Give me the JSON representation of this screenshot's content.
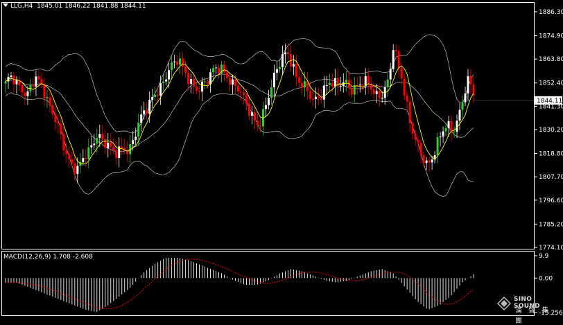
{
  "header": {
    "symbol": "LLG,H4",
    "ohlc": "1845.01 1846.22 1841.88 1844.11"
  },
  "price_axis": {
    "ticks": [
      "1886.30",
      "1874.90",
      "1863.80",
      "1852.40",
      "1841.30",
      "1830.20",
      "1818.80",
      "1807.70",
      "1796.60",
      "1785.20",
      "1774.10"
    ],
    "current_price": "1844.11"
  },
  "macd": {
    "label": "MACD(12,26,9) 1.708 -2.608",
    "ticks": [
      "9.9",
      "0.00",
      "-15.256"
    ]
  },
  "watermark": {
    "line1": "SINO SOUND",
    "line2": "漢 聲 集 團"
  },
  "colors": {
    "up": "#ffffff",
    "down": "#ff0000",
    "green_candle": "#32cd32",
    "ma": "#ffff00",
    "bands": "#c0c0c0",
    "signal": "#ff0000"
  },
  "chart_data": {
    "type": "candlestick",
    "title": "LLG,H4",
    "y_range": [
      1774.1,
      1886.3
    ],
    "close_path": [
      1852,
      1855,
      1853,
      1850,
      1849,
      1847,
      1852,
      1856,
      1853,
      1848,
      1842,
      1838,
      1835,
      1829,
      1822,
      1816,
      1812,
      1810,
      1814,
      1818,
      1821,
      1826,
      1829,
      1825,
      1823,
      1820,
      1818,
      1820,
      1822,
      1821,
      1824,
      1830,
      1835,
      1838,
      1841,
      1846,
      1849,
      1852,
      1856,
      1860,
      1861,
      1863,
      1859,
      1856,
      1853,
      1851,
      1850,
      1852,
      1853,
      1857,
      1859,
      1860,
      1858,
      1855,
      1852,
      1850,
      1846,
      1842,
      1838,
      1835,
      1833,
      1838,
      1844,
      1850,
      1856,
      1861,
      1866,
      1867,
      1862,
      1856,
      1852,
      1850,
      1846,
      1843,
      1845,
      1848,
      1852,
      1854,
      1852,
      1850,
      1852,
      1851,
      1849,
      1851,
      1853,
      1854,
      1852,
      1848,
      1845,
      1845,
      1850,
      1856,
      1872,
      1862,
      1854,
      1842,
      1832,
      1826,
      1822,
      1818,
      1814,
      1816,
      1820,
      1826,
      1830,
      1832,
      1830,
      1834,
      1842,
      1849,
      1854,
      1846
    ],
    "macd_histogram_trend": [
      -2,
      -2,
      -4,
      -6,
      -8,
      -10,
      -12,
      -14,
      -15,
      -12,
      -8,
      -4,
      2,
      6,
      9,
      9,
      8,
      6,
      4,
      2,
      -1,
      -3,
      -3,
      -1,
      2,
      4,
      3,
      1,
      -1,
      -2,
      -1,
      1,
      3,
      4,
      2,
      -4,
      -10,
      -14,
      -12,
      -8,
      -2,
      1.7
    ],
    "macd_signal": -2.608,
    "macd_value": 1.708
  }
}
